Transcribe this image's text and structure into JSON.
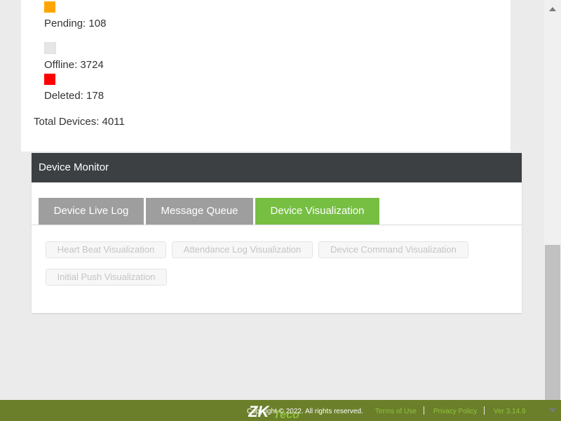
{
  "device_stats": {
    "legend": [
      {
        "label": "Pending: 108",
        "color": "#ffa500"
      },
      {
        "label": "Offline: 3724",
        "color": "#e6e6e6"
      },
      {
        "label": "Deleted: 178",
        "color": "#ff0000"
      }
    ],
    "total": "Total Devices: 4011"
  },
  "device_monitor": {
    "title": "Device Monitor",
    "tabs": [
      {
        "label": "Device Live Log",
        "active": false
      },
      {
        "label": "Message Queue",
        "active": false
      },
      {
        "label": "Device Visualization",
        "active": true
      }
    ],
    "visualization_buttons": [
      "Heart Beat Visualization",
      "Attendance Log Visualization",
      "Device Command Visualization",
      "Initial Push Visualization"
    ]
  },
  "footer": {
    "logo_text": "ZKTeco",
    "copyright": "Copyright © 2022. All rights reserved.",
    "terms": "Terms of Use",
    "privacy": "Privacy Policy",
    "version": "Ver 3.14.9"
  },
  "colors": {
    "active_tab": "#76bf43",
    "inactive_tab": "#9e9e9e",
    "header_bg": "#3d4043",
    "footer_bg": "#6b7f2a",
    "link": "#8fc43a"
  }
}
